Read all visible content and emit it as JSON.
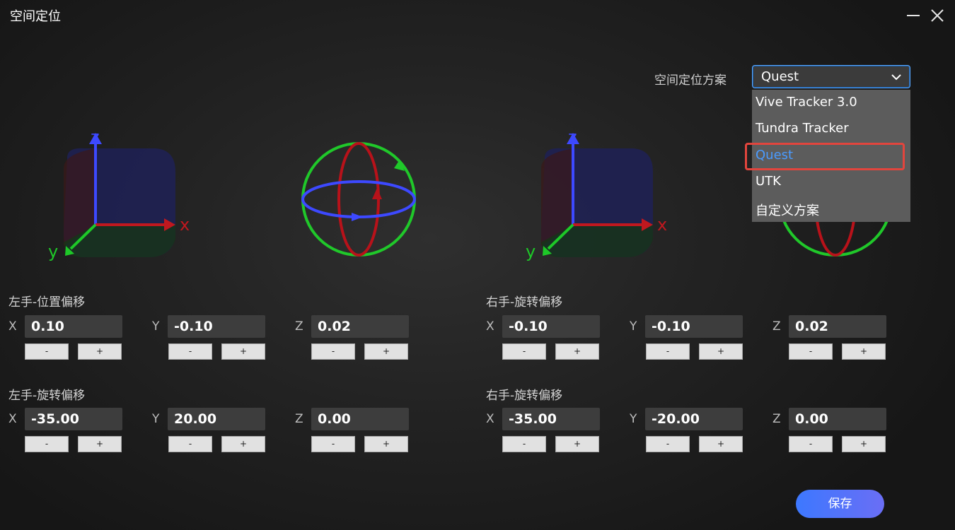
{
  "window": {
    "title": "空间定位"
  },
  "scheme": {
    "label": "空间定位方案",
    "selected": "Quest",
    "options": [
      "Vive Tracker 3.0",
      "Tundra Tracker",
      "Quest",
      "UTK",
      "自定义方案"
    ]
  },
  "axes": {
    "x": "x",
    "y": "y",
    "z": "z"
  },
  "coords": {
    "x": "X",
    "y": "Y",
    "z": "Z"
  },
  "steppers": {
    "minus": "-",
    "plus": "+"
  },
  "left_position": {
    "title": "左手-位置偏移",
    "x": "0.10",
    "y": "-0.10",
    "z": "0.02"
  },
  "left_rotation": {
    "title": "左手-旋转偏移",
    "x": "-35.00",
    "y": "20.00",
    "z": "0.00"
  },
  "right_position": {
    "title": "右手-旋转偏移",
    "x": "-0.10",
    "y": "-0.10",
    "z": "0.02"
  },
  "right_rotation": {
    "title": "右手-旋转偏移",
    "x": "-35.00",
    "y": "-20.00",
    "z": "0.00"
  },
  "actions": {
    "save": "保存"
  },
  "colors": {
    "accent": "#4a9bff",
    "save_start": "#3d78ff",
    "save_end": "#6a6ef5",
    "highlight": "#e2453d"
  }
}
